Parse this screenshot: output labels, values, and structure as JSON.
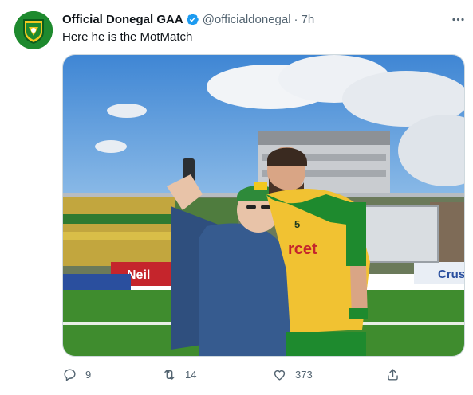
{
  "tweet": {
    "display_name": "Official Donegal GAA",
    "handle": "@officialdonegal",
    "separator": "·",
    "time": "7h",
    "text": "Here he is the MotMatch",
    "verified": true
  },
  "photo": {
    "boards": [
      "Neil",
      "Cruse",
      "rcet"
    ],
    "jersey_number": "5"
  },
  "actions": {
    "replies": "9",
    "retweets": "14",
    "likes": "373"
  },
  "icons": {
    "verified": "verified-badge-icon",
    "more": "more-icon",
    "reply": "reply-icon",
    "retweet": "retweet-icon",
    "like": "heart-icon",
    "share": "share-icon"
  },
  "colors": {
    "verified": "#1d9bf0",
    "secondary_text": "#536471",
    "jersey_gold": "#f1c232",
    "jersey_green": "#1e8a2e"
  }
}
